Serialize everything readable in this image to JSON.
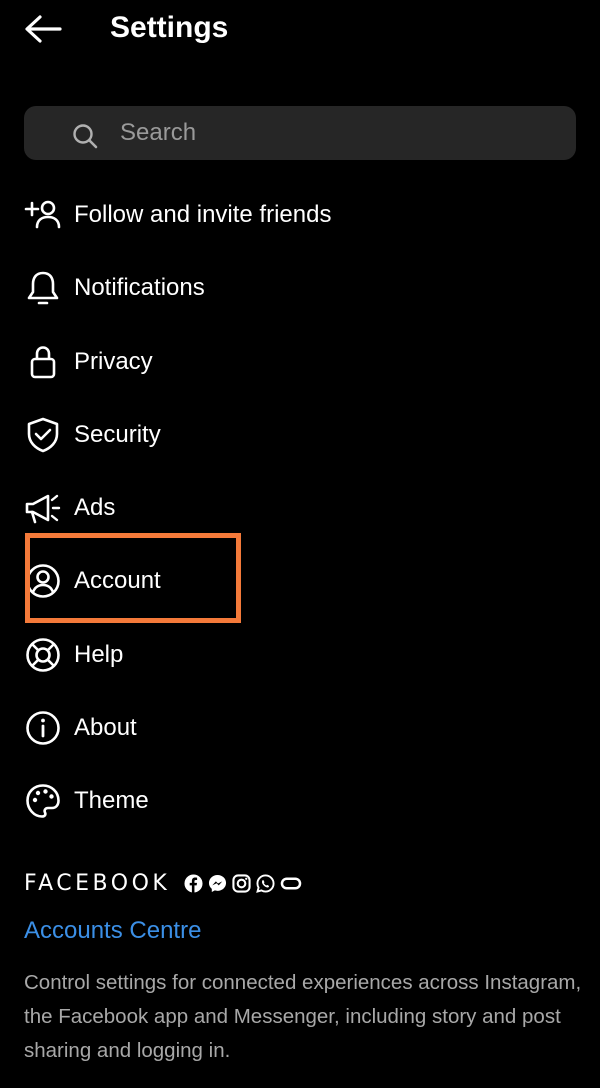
{
  "header": {
    "title": "Settings",
    "back_icon": "arrow-left-icon"
  },
  "search": {
    "placeholder": "Search",
    "value": "",
    "icon": "search-icon"
  },
  "menu": {
    "items": [
      {
        "label": "Follow and invite friends",
        "icon": "add-person-icon"
      },
      {
        "label": "Notifications",
        "icon": "bell-icon"
      },
      {
        "label": "Privacy",
        "icon": "lock-icon"
      },
      {
        "label": "Security",
        "icon": "shield-check-icon"
      },
      {
        "label": "Ads",
        "icon": "megaphone-icon"
      },
      {
        "label": "Account",
        "icon": "user-circle-icon"
      },
      {
        "label": "Help",
        "icon": "lifebuoy-icon"
      },
      {
        "label": "About",
        "icon": "info-icon"
      },
      {
        "label": "Theme",
        "icon": "palette-icon"
      }
    ]
  },
  "highlight": {
    "target": "Account",
    "color": "#f47a3a"
  },
  "facebook": {
    "wordmark": "FACEBOOK",
    "icons": [
      "facebook-icon",
      "messenger-icon",
      "instagram-icon",
      "whatsapp-icon",
      "oculus-icon"
    ]
  },
  "accounts_centre": {
    "link_label": "Accounts Centre",
    "description": "Control settings for connected experiences across Instagram, the Facebook app and Messenger, including story and post sharing and logging in."
  },
  "colors": {
    "background": "#000000",
    "search_bg": "#262626",
    "link": "#3b8fe6",
    "secondary_text": "#a8a8a8"
  }
}
